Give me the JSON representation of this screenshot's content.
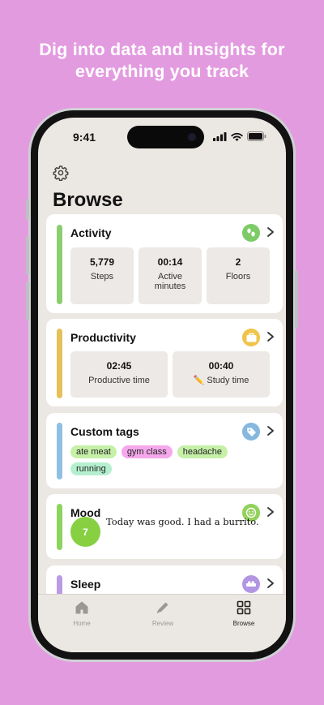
{
  "headline": {
    "line1": "Dig into data and insights for",
    "line2": "everything you track"
  },
  "status_bar": {
    "time": "9:41"
  },
  "page": {
    "title": "Browse"
  },
  "icons": {
    "settings": "gear-icon",
    "chevron": "chevron-right-icon"
  },
  "activity": {
    "title": "Activity",
    "color": "#8bce6e",
    "icon_color": "#7ccb67",
    "stats": [
      {
        "value": "5,779",
        "label": "Steps"
      },
      {
        "value": "00:14",
        "label": "Active minutes"
      },
      {
        "value": "2",
        "label": "Floors"
      }
    ]
  },
  "productivity": {
    "title": "Productivity",
    "color": "#e6c15a",
    "icon_color": "#f0c34a",
    "stats": [
      {
        "value": "02:45",
        "label": "Productive time"
      },
      {
        "value": "00:40",
        "label": "✏️ Study time"
      }
    ]
  },
  "custom_tags": {
    "title": "Custom tags",
    "color": "#8fbfe2",
    "icon_color": "#86b8df",
    "tags": [
      {
        "label": "ate meat",
        "color": "#c6f0a8"
      },
      {
        "label": "gym class",
        "color": "#f5a8ec"
      },
      {
        "label": "headache",
        "color": "#c6f0a8"
      },
      {
        "label": "running",
        "color": "#b4f0cf"
      }
    ]
  },
  "mood": {
    "title": "Mood",
    "color": "#8dd35c",
    "icon_color": "#92d15a",
    "score": "7",
    "note": "Today was good. I had a burrito."
  },
  "sleep": {
    "title": "Sleep",
    "color": "#b99be6",
    "icon_color": "#b295e3"
  },
  "tabbar": {
    "items": [
      {
        "label": "Home",
        "active": false
      },
      {
        "label": "Review",
        "active": false
      },
      {
        "label": "Browse",
        "active": true
      }
    ]
  }
}
